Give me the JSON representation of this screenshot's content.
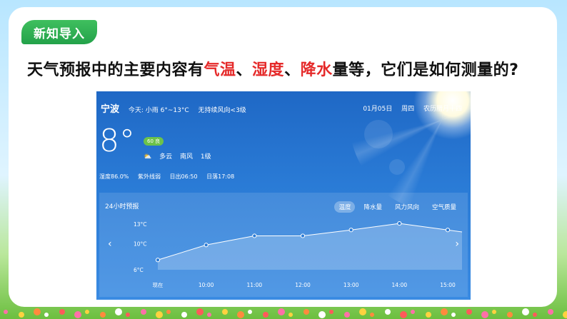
{
  "slide": {
    "badge": "新知导入",
    "question_parts": [
      {
        "text": "天气预报中的主要内容有",
        "red": false
      },
      {
        "text": "气温",
        "red": true
      },
      {
        "text": "、",
        "red": false
      },
      {
        "text": "湿度",
        "red": true
      },
      {
        "text": "、",
        "red": false
      },
      {
        "text": "降水",
        "red": true
      },
      {
        "text": "量等，它们是如何测量的?",
        "red": false
      }
    ]
  },
  "weather": {
    "city": "宁波",
    "today": "今天: 小雨 6°~13°C",
    "wind_today": "无持续风向<3级",
    "date": "01月05日",
    "weekday": "周四",
    "lunar": "农历腊月十四",
    "temp": "8°",
    "aqi": "60 良",
    "condition": "多云",
    "wind_dir": "南风",
    "wind_level": "1级",
    "humidity": "湿度86.0%",
    "uv": "紫外线弱",
    "sunrise": "日出06:50",
    "sunset": "日落17:08"
  },
  "forecast": {
    "title": "24小时预报",
    "tabs": [
      "温度",
      "降水量",
      "风力风向",
      "空气质量"
    ],
    "active_tab": 0,
    "prev_icon": "chevron-left-icon",
    "next_icon": "chevron-right-icon"
  },
  "chart_data": {
    "type": "area",
    "x": [
      "现在",
      "10:00",
      "11:00",
      "12:00",
      "13:00",
      "14:00",
      "15:00"
    ],
    "values": [
      7.5,
      9.8,
      11.2,
      11.2,
      12.1,
      13.1,
      12.1
    ],
    "ytick_labels": [
      "13°C",
      "10°C",
      "6°C"
    ],
    "yticks": [
      13,
      10,
      6
    ],
    "ylim": [
      6,
      13
    ]
  },
  "colors": {
    "accent_red": "#e52a2a",
    "badge_green": "#2fb155",
    "panel_blue": "#2a7bd6"
  }
}
